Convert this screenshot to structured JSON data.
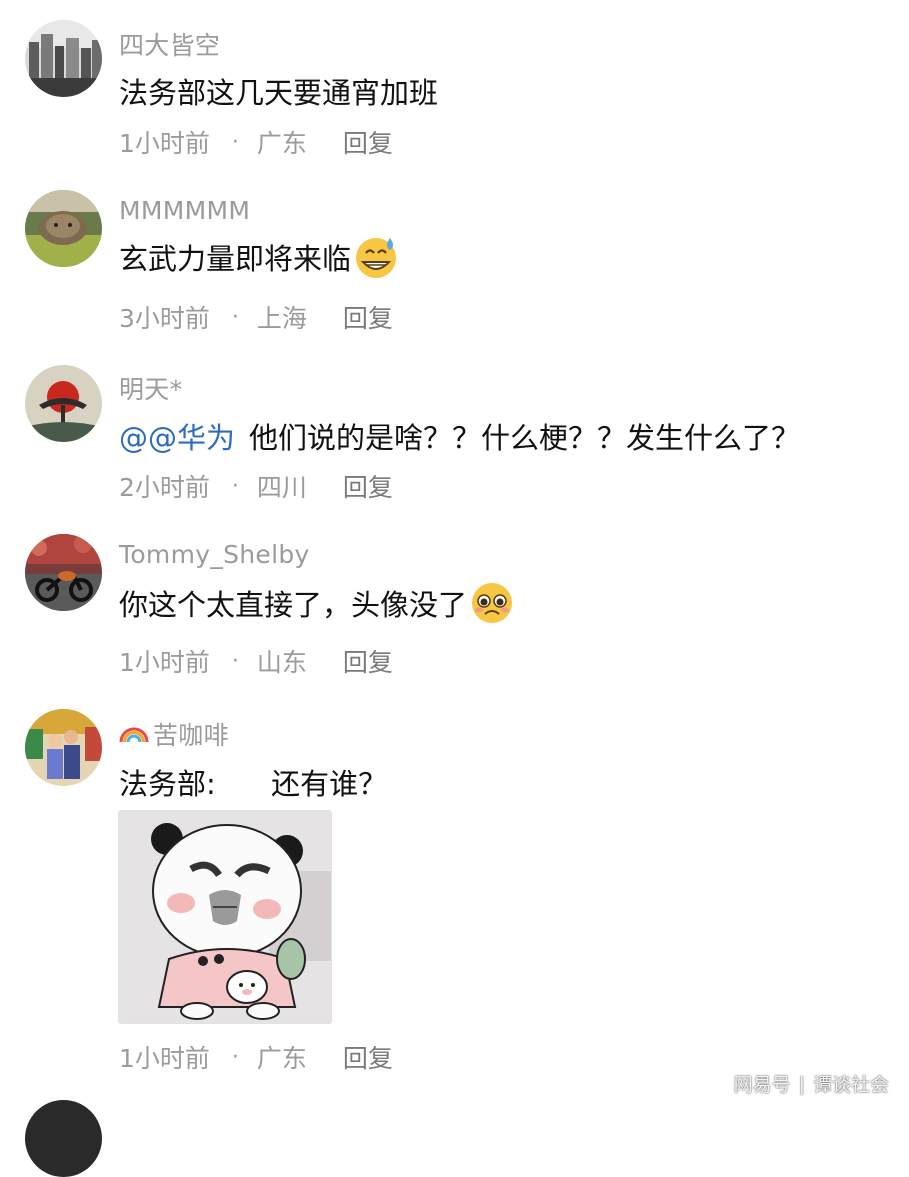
{
  "comments": [
    {
      "username": "四大皆空",
      "text": "法务部这几天要通宵加班",
      "time": "1小时前",
      "location": "广东",
      "reply_label": "回复",
      "avatar_icon": "city-buildings-avatar"
    },
    {
      "username": "MMMMMM",
      "text": "玄武力量即将来临",
      "emoji": "grinning-sweat-emoji",
      "time": "3小时前",
      "location": "上海",
      "reply_label": "回复",
      "avatar_icon": "cat-avatar"
    },
    {
      "username": "明天*",
      "mention": "@@华为",
      "text": "他们说的是啥？？什么梗？？发生什么了？",
      "time": "2小时前",
      "location": "四川",
      "reply_label": "回复",
      "avatar_icon": "red-sun-tree-avatar"
    },
    {
      "username": "Tommy_Shelby",
      "text": "你这个太直接了，头像没了",
      "emoji": "pleading-face-emoji",
      "time": "1小时前",
      "location": "山东",
      "reply_label": "回复",
      "avatar_icon": "motorcycle-avatar"
    },
    {
      "username": "苦咖啡",
      "username_prefix_icon": "rainbow-icon",
      "text": "法务部:      还有谁？",
      "sticker": "panda-meme-sticker",
      "time": "1小时前",
      "location": "广东",
      "reply_label": "回复",
      "avatar_icon": "couple-photo-avatar"
    }
  ],
  "meta_separator": "·",
  "watermark": {
    "brand": "网易号",
    "separator": "|",
    "account": "谭谈社会"
  },
  "colors": {
    "username": "#9b9b9b",
    "mention": "#2f6bbf",
    "text": "#111111"
  }
}
